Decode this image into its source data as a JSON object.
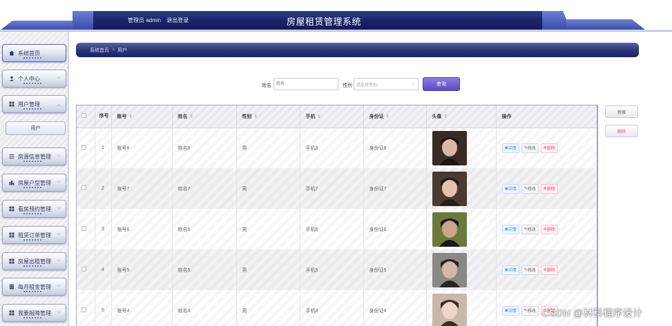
{
  "header": {
    "user_text": "管理员 admin",
    "logout": "退出登录",
    "title": "房屋租赁管理系统"
  },
  "sidebar": {
    "items": [
      {
        "label": "系统首页",
        "icon": "home-icon"
      },
      {
        "label": "个人中心",
        "icon": "person-icon"
      },
      {
        "label": "用户管理",
        "icon": "grid-icon"
      },
      {
        "label": "房源信息管理",
        "icon": "list-icon"
      },
      {
        "label": "房屋户型管理",
        "icon": "chart-icon"
      },
      {
        "label": "看房预约管理",
        "icon": "grid-icon"
      },
      {
        "label": "租赁订单管理",
        "icon": "grid-icon"
      },
      {
        "label": "房屋出租管理",
        "icon": "grid-icon"
      },
      {
        "label": "每月租金管理",
        "icon": "building-icon"
      },
      {
        "label": "我要报障管理",
        "icon": "grid-icon"
      }
    ],
    "sub_item": "用户"
  },
  "breadcrumb": {
    "home": "系统首页",
    "separator": ">",
    "current": "用户"
  },
  "search": {
    "name_label": "姓名",
    "name_placeholder": "姓名",
    "gender_label": "性别",
    "gender_placeholder": "请选择性别",
    "button": "查询"
  },
  "actions": {
    "add": "新增",
    "delete": "删除"
  },
  "table": {
    "headers": {
      "index": "序号",
      "account": "账号",
      "name": "姓名",
      "gender": "性别",
      "phone": "手机",
      "id_card": "身份证",
      "avatar": "头像",
      "ops": "操作"
    },
    "op_labels": {
      "detail": "详情",
      "edit": "修改",
      "remove": "删除"
    },
    "rows": [
      {
        "index": "1",
        "account": "账号8",
        "name": "姓名8",
        "gender": "男",
        "phone": "手机8",
        "id_card": "身份证8"
      },
      {
        "index": "2",
        "account": "账号7",
        "name": "姓名7",
        "gender": "男",
        "phone": "手机7",
        "id_card": "身份证7"
      },
      {
        "index": "3",
        "account": "账号6",
        "name": "姓名6",
        "gender": "男",
        "phone": "手机6",
        "id_card": "身份证6"
      },
      {
        "index": "4",
        "account": "账号5",
        "name": "姓名5",
        "gender": "男",
        "phone": "手机5",
        "id_card": "身份证5"
      },
      {
        "index": "5",
        "account": "账号4",
        "name": "姓名4",
        "gender": "男",
        "phone": "手机4",
        "id_card": "身份证4"
      }
    ]
  },
  "watermark": "CSDN @林科程序设计",
  "colors": {
    "header_dark": "#1c2566",
    "accent_purple": "#5a4cc0",
    "danger": "#e0566b",
    "info": "#4a8bdc"
  }
}
